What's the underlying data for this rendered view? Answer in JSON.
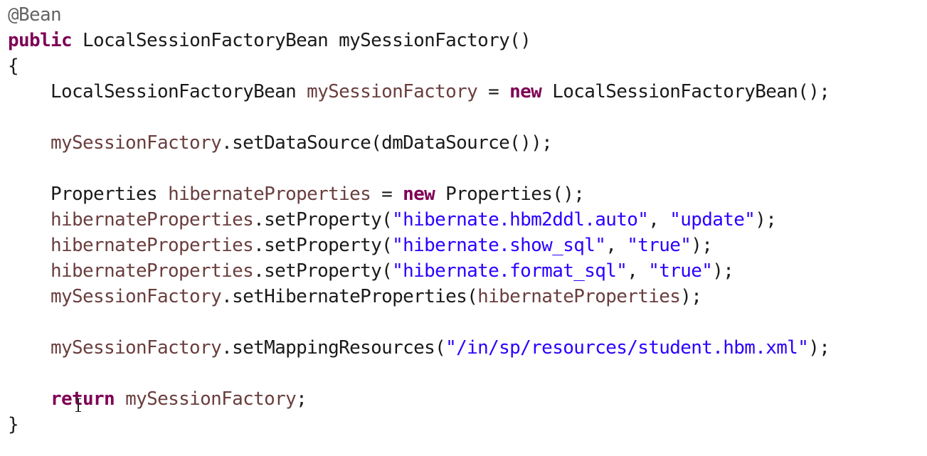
{
  "editor": {
    "language": "java",
    "colors": {
      "keyword": "#7f0055",
      "field": "#6a3e3e",
      "string": "#2a00ff",
      "annotation": "#646464",
      "plain": "#1a1a1a",
      "background": "#ffffff"
    },
    "lines": [
      [
        {
          "t": "annotation",
          "v": "@Bean"
        }
      ],
      [
        {
          "t": "keyword",
          "v": "public"
        },
        {
          "t": "plain",
          "v": " LocalSessionFactoryBean mySessionFactory()"
        }
      ],
      [
        {
          "t": "plain",
          "v": "{"
        }
      ],
      [
        {
          "t": "plain",
          "v": "    LocalSessionFactoryBean "
        },
        {
          "t": "field",
          "v": "mySessionFactory"
        },
        {
          "t": "plain",
          "v": " = "
        },
        {
          "t": "keyword",
          "v": "new"
        },
        {
          "t": "plain",
          "v": " LocalSessionFactoryBean();"
        }
      ],
      [],
      [
        {
          "t": "plain",
          "v": "    "
        },
        {
          "t": "field",
          "v": "mySessionFactory"
        },
        {
          "t": "plain",
          "v": ".setDataSource(dmDataSource());"
        }
      ],
      [],
      [
        {
          "t": "plain",
          "v": "    Properties "
        },
        {
          "t": "field",
          "v": "hibernateProperties"
        },
        {
          "t": "plain",
          "v": " = "
        },
        {
          "t": "keyword",
          "v": "new"
        },
        {
          "t": "plain",
          "v": " Properties();"
        }
      ],
      [
        {
          "t": "plain",
          "v": "    "
        },
        {
          "t": "field",
          "v": "hibernateProperties"
        },
        {
          "t": "plain",
          "v": ".setProperty("
        },
        {
          "t": "string",
          "v": "\"hibernate.hbm2ddl.auto\""
        },
        {
          "t": "plain",
          "v": ", "
        },
        {
          "t": "string",
          "v": "\"update\""
        },
        {
          "t": "plain",
          "v": ");"
        }
      ],
      [
        {
          "t": "plain",
          "v": "    "
        },
        {
          "t": "field",
          "v": "hibernateProperties"
        },
        {
          "t": "plain",
          "v": ".setProperty("
        },
        {
          "t": "string",
          "v": "\"hibernate.show_sql\""
        },
        {
          "t": "plain",
          "v": ", "
        },
        {
          "t": "string",
          "v": "\"true\""
        },
        {
          "t": "plain",
          "v": ");"
        }
      ],
      [
        {
          "t": "plain",
          "v": "    "
        },
        {
          "t": "field",
          "v": "hibernateProperties"
        },
        {
          "t": "plain",
          "v": ".setProperty("
        },
        {
          "t": "string",
          "v": "\"hibernate.format_sql\""
        },
        {
          "t": "plain",
          "v": ", "
        },
        {
          "t": "string",
          "v": "\"true\""
        },
        {
          "t": "plain",
          "v": ");"
        }
      ],
      [
        {
          "t": "plain",
          "v": "    "
        },
        {
          "t": "field",
          "v": "mySessionFactory"
        },
        {
          "t": "plain",
          "v": ".setHibernateProperties("
        },
        {
          "t": "field",
          "v": "hibernateProperties"
        },
        {
          "t": "plain",
          "v": ");"
        }
      ],
      [],
      [
        {
          "t": "plain",
          "v": "    "
        },
        {
          "t": "field",
          "v": "mySessionFactory"
        },
        {
          "t": "plain",
          "v": ".setMappingResources("
        },
        {
          "t": "string",
          "v": "\"/in/sp/resources/student.hbm.xml\""
        },
        {
          "t": "plain",
          "v": ");"
        }
      ],
      [],
      [
        {
          "t": "plain",
          "v": "    "
        },
        {
          "t": "keyword",
          "v": "return"
        },
        {
          "t": "plain",
          "v": " "
        },
        {
          "t": "field",
          "v": "mySessionFactory"
        },
        {
          "t": "plain",
          "v": ";"
        }
      ],
      [
        {
          "t": "plain",
          "v": "}"
        }
      ]
    ]
  },
  "cursor": {
    "icon": "text-cursor-icon"
  }
}
